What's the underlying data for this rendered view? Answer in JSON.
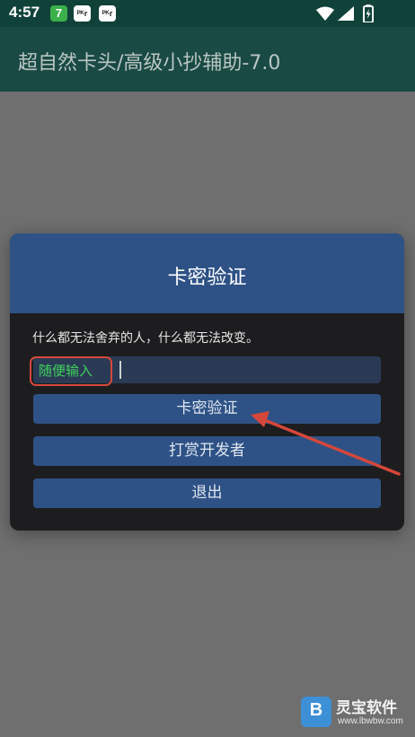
{
  "status_bar": {
    "time": "4:57",
    "app_icons": [
      "7",
      "ᴾᴷr",
      "ᴾᴷr"
    ],
    "icons": [
      "wifi-icon",
      "signal-icon",
      "battery-icon"
    ]
  },
  "app_bar": {
    "title": "超自然卡头/高级小抄辅助-7.0"
  },
  "dialog": {
    "title": "卡密验证",
    "message": "什么都无法舍弃的人，什么都无法改变。",
    "input_value": "随便输入",
    "buttons": {
      "verify": "卡密验证",
      "tip": "打赏开发者",
      "exit": "退出"
    }
  },
  "watermark": {
    "name": "灵宝软件",
    "url": "www.lbwbw.com"
  },
  "colors": {
    "status_bar": "#11423a",
    "app_bar": "#1a4a44",
    "dialog_header": "#2e5286",
    "dialog_body": "#1d1d1f",
    "button": "#2e5286",
    "input_text": "#3fd25a",
    "annotation": "#d5473a"
  }
}
